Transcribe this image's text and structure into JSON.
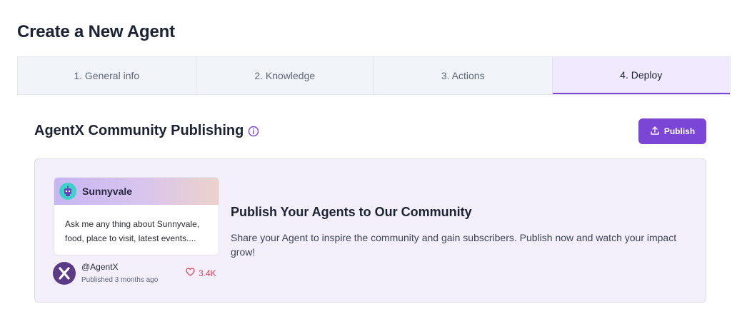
{
  "page": {
    "title": "Create a New Agent"
  },
  "tabs": [
    {
      "label": "1. General info"
    },
    {
      "label": "2. Knowledge"
    },
    {
      "label": "3. Actions"
    },
    {
      "label": "4. Deploy",
      "active": true
    }
  ],
  "section": {
    "title": "AgentX Community Publishing",
    "info_icon": "info-circle-icon",
    "publish_label": "Publish",
    "publish_icon": "upload-icon"
  },
  "card": {
    "name": "Sunnyvale",
    "description": "Ask me any thing about Sunnyvale, food, place to visit, latest events....",
    "author": "@AgentX",
    "published": "Published 3 months ago",
    "likes": "3.4K"
  },
  "promo": {
    "title": "Publish Your Agents to Our Community",
    "text": "Share your Agent to inspire the community and gain subscribers. Publish now and watch your impact grow!"
  },
  "colors": {
    "accent": "#7b45d6",
    "panel_bg": "#f3f0fb",
    "active_tab_bg": "#f1e9fd",
    "like": "#e0405a"
  }
}
